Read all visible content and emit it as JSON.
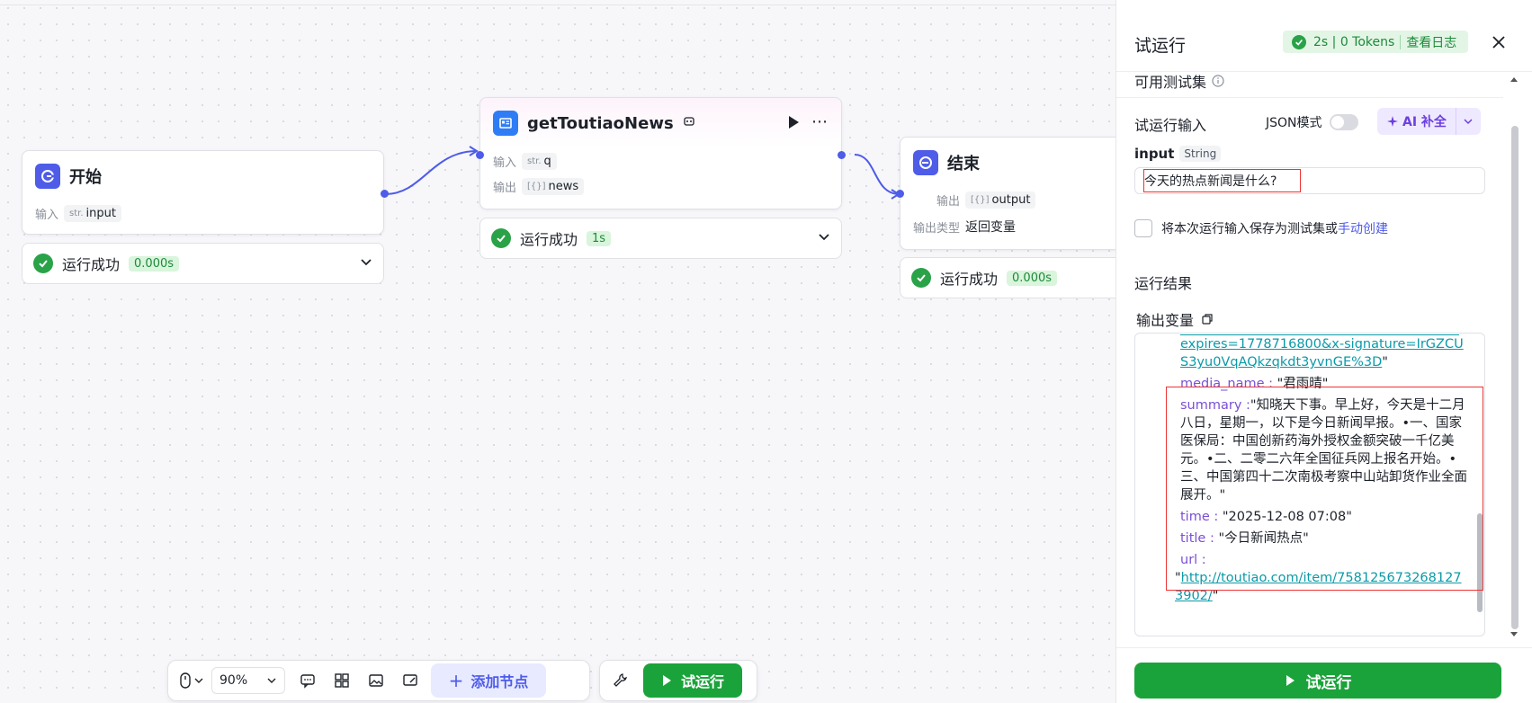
{
  "colors": {
    "accent": "#4e5ce8",
    "success": "#2aa248",
    "run_button": "#1aa33a",
    "highlight": "#e33"
  },
  "nodes": {
    "start": {
      "title": "开始",
      "input_label": "输入",
      "input_type": "str.",
      "input_name": "input",
      "status": "运行成功",
      "duration": "0.000s"
    },
    "plugin": {
      "title": "getToutiaoNews",
      "input_label": "输入",
      "input_type": "str.",
      "input_name": "q",
      "output_label": "输出",
      "output_type": "[{}]",
      "output_name": "news",
      "status": "运行成功",
      "duration": "1s"
    },
    "end": {
      "title": "结束",
      "output_label": "输出",
      "output_type": "[{}]",
      "output_name": "output",
      "output_kind_label": "输出类型",
      "output_kind_value": "返回变量",
      "status": "运行成功",
      "duration": "0.000s"
    }
  },
  "toolbar": {
    "zoom": "90%",
    "add_node": "添加节点",
    "run": "试运行"
  },
  "panel": {
    "title": "试运行",
    "badge_stats": "2s | 0 Tokens",
    "badge_link": "查看日志",
    "testset_label": "可用测试集",
    "run_input_label": "试运行输入",
    "json_mode_label": "JSON模式",
    "ai_complete_label": "AI 补全",
    "input_name": "input",
    "input_type": "String",
    "input_value": "今天的热点新闻是什么?",
    "save_text": "将本次运行输入保存为测试集或",
    "save_link": "手动创建",
    "result_label": "运行结果",
    "output_var_label": "输出变量",
    "output": {
      "url_tail": "expires=1778716800&x-signature=IrGZCUS3yu0VqAQkzqkdt3yvnGE%3D",
      "url_tail_close": "\"",
      "media_name_key": "media_name :",
      "media_name_val": "\"君雨晴\"",
      "summary_key": "summary :",
      "summary_val": "\"知晓天下事。早上好，今天是十二月八日，星期一，以下是今日新闻早报。•一、国家医保局：中国创新药海外授权金额突破一千亿美元。•二、二零二六年全国征兵网上报名开始。•三、中国第四十二次南极考察中山站卸货作业全面展开。\"",
      "time_key": "time :",
      "time_val": "\"2025-12-08 07:08\"",
      "title_key": "title :",
      "title_val": "\"今日新闻热点\"",
      "url_key": "url :",
      "url_val": "http://toutiao.com/item/7581256732681273902/"
    },
    "run_button": "试运行"
  }
}
